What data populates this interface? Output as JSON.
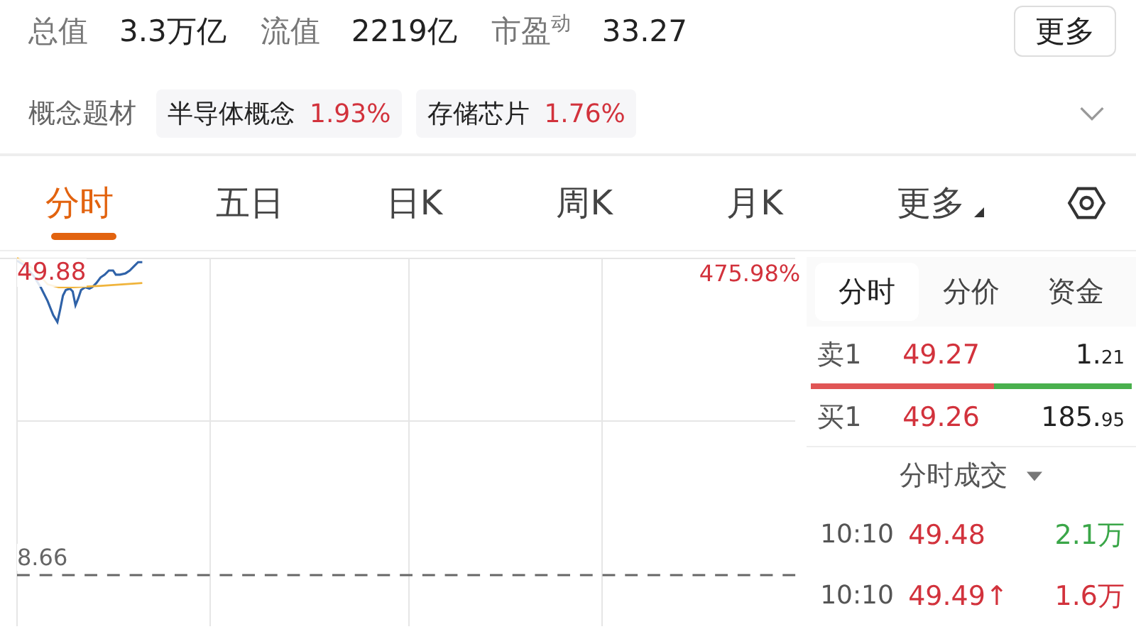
{
  "stats": [
    {
      "label": "总值",
      "value": "3.3万亿"
    },
    {
      "label": "流值",
      "value": "2219亿"
    },
    {
      "label": "市盈$^{动}$",
      "value": "33.27"
    }
  ],
  "more_button": "更多",
  "concepts": {
    "label": "概念题材",
    "tags": [
      {
        "name": "半导体概念",
        "change": "1.93%"
      },
      {
        "name": "存储芯片",
        "change": "1.76%"
      }
    ],
    "expanded": false
  },
  "chart_tabs": [
    {
      "label": "分时",
      "selected": true,
      "dropdown": false
    },
    {
      "label": "五日",
      "selected": false,
      "dropdown": false
    },
    {
      "label": "日K",
      "selected": false,
      "dropdown": false
    },
    {
      "label": "周K",
      "selected": false,
      "dropdown": false
    },
    {
      "label": "月K",
      "selected": false,
      "dropdown": false
    },
    {
      "label": "更多",
      "selected": false,
      "dropdown": true
    }
  ],
  "chart": {
    "high_price": "49.88",
    "high_change": "475.98%",
    "base_price": "8.66"
  },
  "panel_tabs": [
    {
      "label": "分时",
      "selected": true
    },
    {
      "label": "分价",
      "selected": false
    },
    {
      "label": "资金",
      "selected": false
    }
  ],
  "order_book": {
    "ask": {
      "label": "卖1",
      "price": "49.27",
      "volume": "1.21"
    },
    "bid": {
      "label": "买1",
      "price": "49.26",
      "volume": "185.95"
    },
    "level": 0.57
  },
  "trades": {
    "title": "分时成交",
    "rows": [
      {
        "time": "10:10",
        "price": "49.48",
        "volume": "2.1万",
        "color": "#3aa648"
      },
      {
        "time": "10:10",
        "price": "49.49↑",
        "volume": "1.6万",
        "color": "#d2323c"
      }
    ]
  }
}
